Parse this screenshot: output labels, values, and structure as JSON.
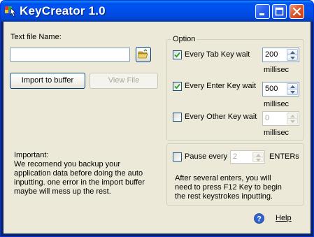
{
  "window": {
    "title": "KeyCreator 1.0",
    "controls": [
      "minimize-icon",
      "maximize-icon",
      "close-icon"
    ]
  },
  "file": {
    "label": "Text file Name:",
    "value": "",
    "browse_icon": "folder-open-icon"
  },
  "buttons": {
    "import": "Import to buffer",
    "view": "View File"
  },
  "important": {
    "heading": "Important:",
    "lines": [
      "We recomend you backup your",
      "application data before doing the auto",
      "inputting. one error in the import buffer",
      "maybe will mess up the rest."
    ]
  },
  "option": {
    "legend": "Option",
    "tab": {
      "label": "Every Tab Key wait",
      "checked": true,
      "value": "200",
      "unit": "millisec"
    },
    "enter": {
      "label": "Every Enter Key wait",
      "checked": true,
      "value": "500",
      "unit": "millisec"
    },
    "other": {
      "label": "Every Other Key wait",
      "checked": false,
      "value": "0",
      "unit": "millisec"
    }
  },
  "pause": {
    "label": "Pause every",
    "checked": false,
    "value": "2",
    "suffix": "ENTERs",
    "note": [
      "After several enters, you will",
      "need to press F12 Key to begin",
      "the rest keystrokes inputting."
    ]
  },
  "help": {
    "label": "Help",
    "icon": "help-icon"
  },
  "colors": {
    "titlebar": "#0053ee",
    "face": "#ece9d8",
    "close": "#e0552c"
  }
}
